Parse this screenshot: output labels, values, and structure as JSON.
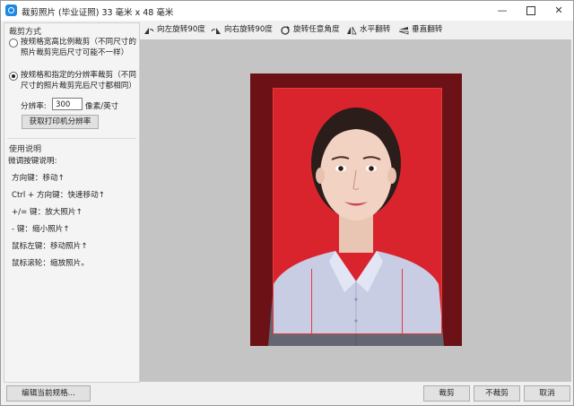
{
  "window": {
    "title": "裁剪照片 (毕业证照) 33 毫米 x 48 毫米",
    "minimize": "—",
    "close": "✕"
  },
  "crop_mode": {
    "title": "裁剪方式",
    "option_ratio": "按规格宽高比例裁剪（不同尺寸的照片裁剪完后尺寸可能不一样）",
    "option_resolution": "按规格和指定的分辨率裁剪（不同尺寸的照片裁剪完后尺寸都相同）",
    "selected": "option_resolution",
    "resolution_label": "分辨率:",
    "resolution_value": "300",
    "resolution_unit": "像素/英寸",
    "printer_button": "获取打印机分辨率"
  },
  "help": {
    "title": "使用说明",
    "subtitle": "微调按键说明:",
    "lines": [
      "方向键：移动↑",
      "Ctrl + 方向键：快速移动↑",
      "+/= 键：放大照片↑",
      "- 键：缩小照片↑",
      "鼠标左键：移动照片↑",
      "鼠标滚轮：缩放照片。"
    ]
  },
  "toolbar": {
    "rotate_left": "向左旋转90度",
    "rotate_right": "向右旋转90度",
    "rotate_any": "旋转任意角度",
    "flip_h": "水平翻转",
    "flip_v": "垂直翻转"
  },
  "footer": {
    "edit_spec": "编辑当前规格...",
    "crop": "裁剪",
    "no_crop": "不裁剪",
    "cancel": "取消"
  },
  "colors": {
    "photo_background": "#d9242e",
    "crop_border": "#e53a3a"
  }
}
